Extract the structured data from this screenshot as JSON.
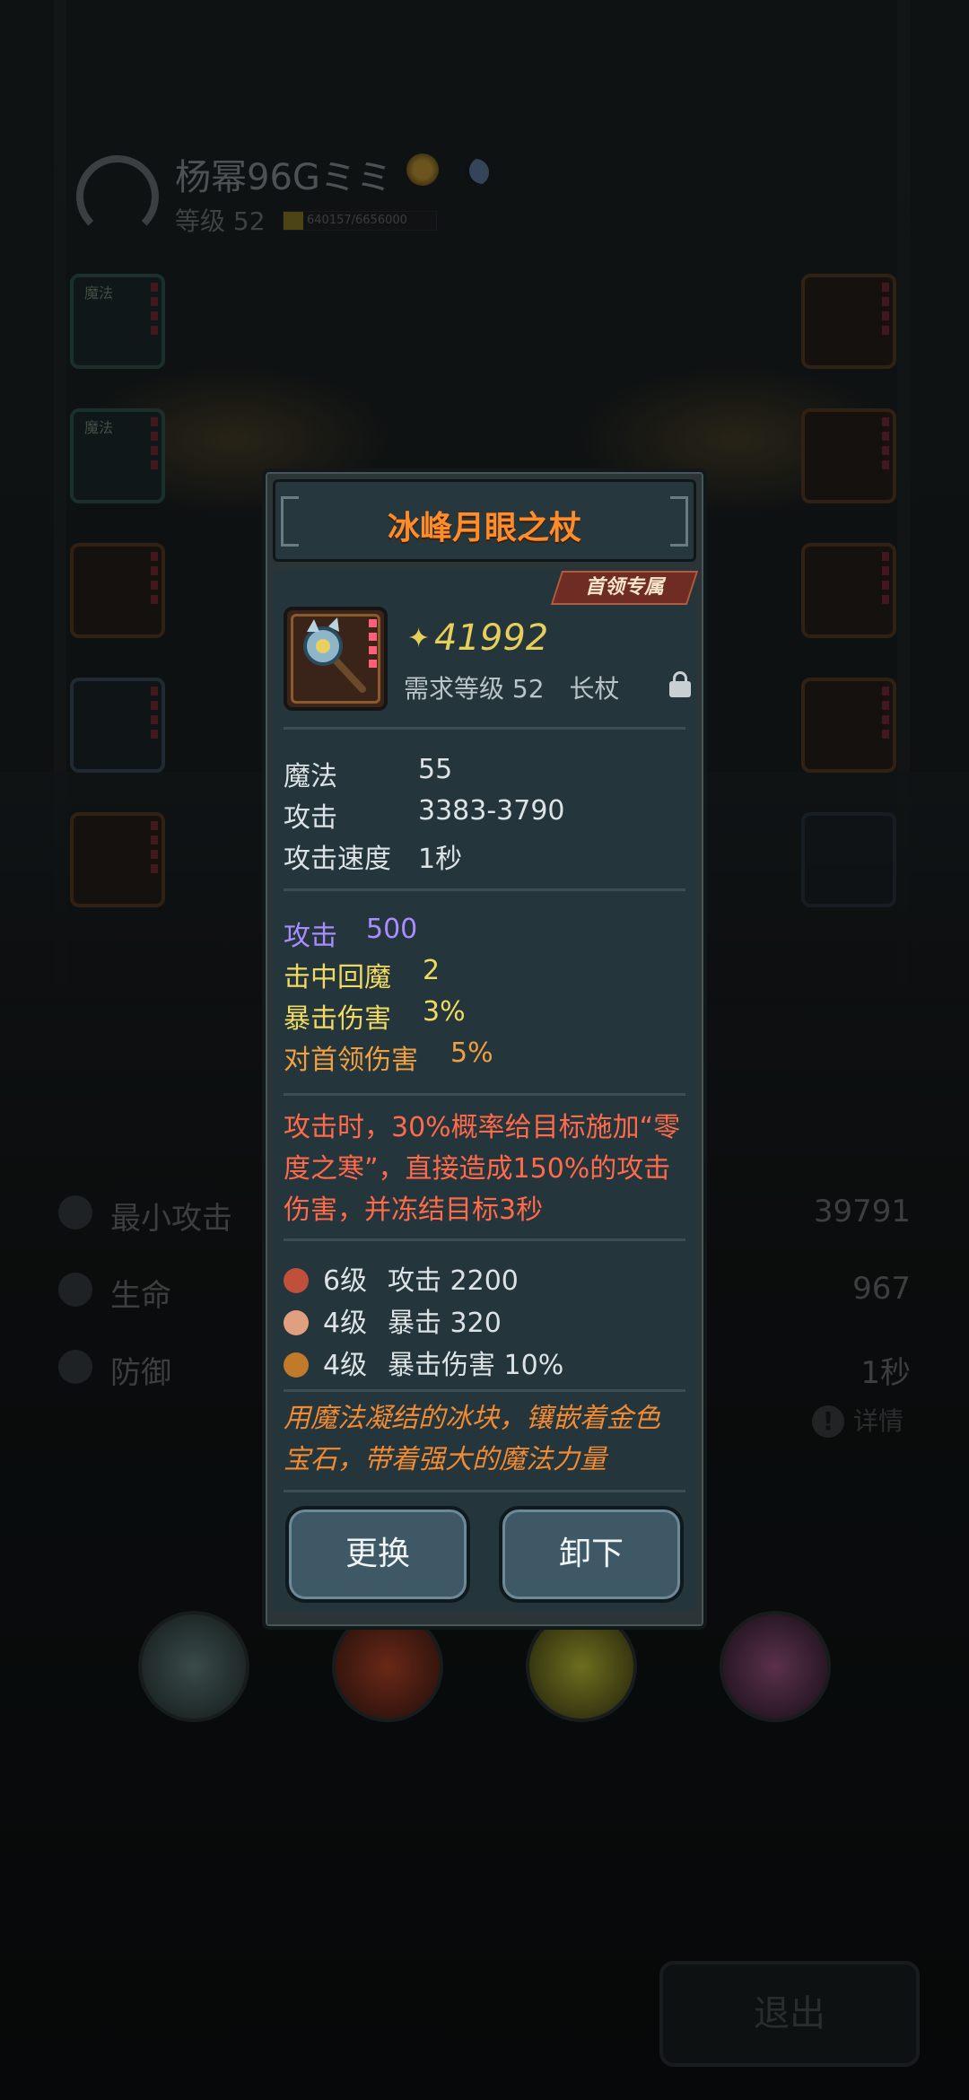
{
  "background": {
    "player_name": "杨幂96Gミミ",
    "level": "等级 52",
    "xp_text": "640157/6656000",
    "slot_tags": [
      "魔法",
      "魔法"
    ],
    "stats": [
      {
        "name": "最小攻击",
        "value": "39791",
        "icon": "sword-icon"
      },
      {
        "name": "生命",
        "value": "967",
        "icon": "heart-icon"
      },
      {
        "name": "防御",
        "value": "1秒",
        "icon": "shield-icon"
      }
    ],
    "detail_label": "详情",
    "exit_label": "退出"
  },
  "modal": {
    "title": "冰峰月眼之杖",
    "boss_tag": "首领专属",
    "power": "41992",
    "requirement": "需求等级 52",
    "item_type": "长杖",
    "base_stats": [
      {
        "name": "魔法",
        "value": "55"
      },
      {
        "name": "攻击",
        "value": "3383-3790"
      },
      {
        "name": "攻击速度",
        "value": "1秒"
      }
    ],
    "bonus_stats": [
      {
        "name": "攻击",
        "value": "500",
        "color": "#a98cff"
      },
      {
        "name": "击中回魔",
        "value": "2",
        "color": "#f1da62"
      },
      {
        "name": "暴击伤害",
        "value": "3%",
        "color": "#f1da62"
      },
      {
        "name": "对首领伤害",
        "value": "5%",
        "color": "#f0a041"
      }
    ],
    "special_effect": "攻击时，30%概率给目标施加“零度之寒”，直接造成150%的攻击伤害，并冻结目标3秒",
    "gems": [
      {
        "level": "6级",
        "effect": "攻击 2200",
        "color": "#c0503a"
      },
      {
        "level": "4级",
        "effect": "暴击 320",
        "color": "#e0a080"
      },
      {
        "level": "4级",
        "effect": "暴击伤害 10%",
        "color": "#c07a2a"
      }
    ],
    "flavor": "用魔法凝结的冰块，镶嵌着金色宝石，带着强大的魔法力量",
    "replace_label": "更换",
    "unequip_label": "卸下"
  }
}
